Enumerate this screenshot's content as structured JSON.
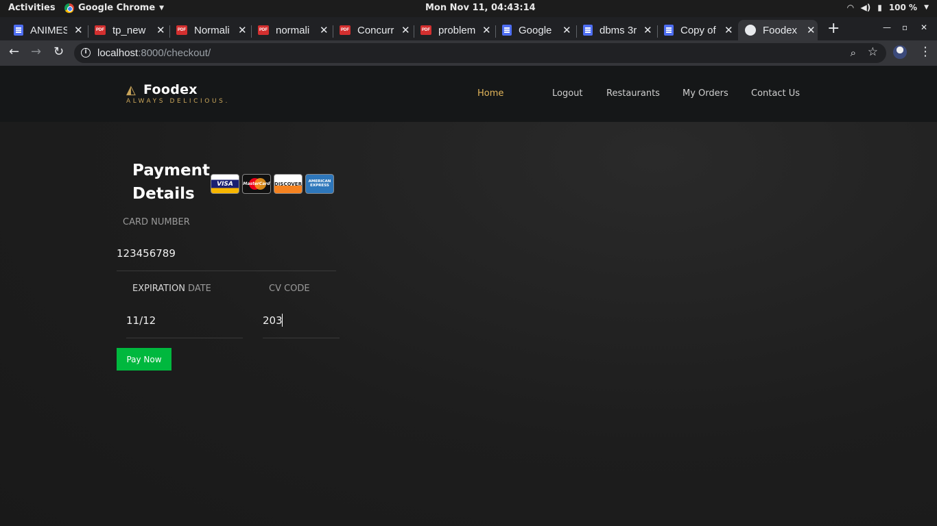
{
  "system_bar": {
    "activities": "Activities",
    "app_name": "Google Chrome",
    "clock": "Mon Nov 11, 04:43:14",
    "battery": "100 %"
  },
  "browser": {
    "tabs": [
      {
        "label": "ANIMES",
        "icon": "doc-icon"
      },
      {
        "label": "tp_new",
        "icon": "pdf-icon"
      },
      {
        "label": "Normali",
        "icon": "pdf-icon"
      },
      {
        "label": "normali",
        "icon": "pdf-icon"
      },
      {
        "label": "Concurr",
        "icon": "pdf-icon"
      },
      {
        "label": "problem",
        "icon": "pdf-icon"
      },
      {
        "label": "Google",
        "icon": "doc-icon"
      },
      {
        "label": "dbms 3r",
        "icon": "doc-icon"
      },
      {
        "label": "Copy of",
        "icon": "doc-icon"
      },
      {
        "label": "Foodex",
        "icon": "globe-icon",
        "active": true
      }
    ],
    "pdf_badge": "PDF",
    "url_host": "localhost",
    "url_path": ":8000/checkout/"
  },
  "site": {
    "brand": "Foodex",
    "tagline": "ALWAYS DELICIOUS.",
    "nav": {
      "home": "Home",
      "logout": "Logout",
      "restaurants": "Restaurants",
      "my_orders": "My Orders",
      "contact": "Contact Us"
    }
  },
  "payment": {
    "title_line1": "Payment",
    "title_line2": "Details",
    "card_logos": {
      "visa": "VISA",
      "mastercard": "MasterCard",
      "discover": "DISCOVER",
      "amex": "AMERICAN EXPRESS"
    },
    "card_number_label": "CARD NUMBER",
    "card_number_value": "123456789",
    "expiration_label_a": "EXPIRATION",
    "expiration_label_b": " DATE",
    "expiration_value": "11/12",
    "cv_label": "CV CODE",
    "cv_value": "203",
    "pay_button": "Pay Now"
  },
  "colors": {
    "accent_gold": "#e3b65a",
    "pay_green": "#00b83e",
    "background": "#1d1d1d"
  }
}
